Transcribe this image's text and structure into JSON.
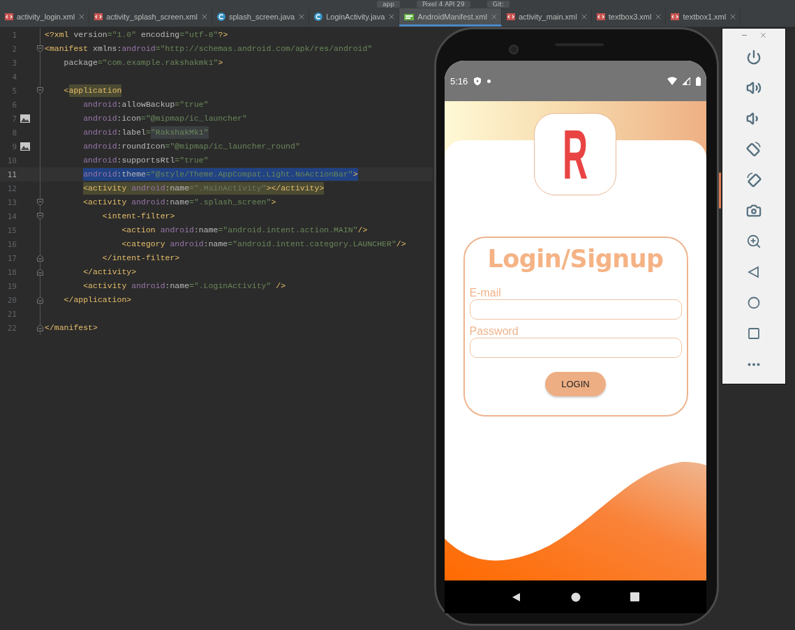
{
  "toolbar": {
    "items": [
      "app",
      "Pixel 4 API 29",
      "Git:"
    ]
  },
  "tabs": [
    {
      "label": "activity_login.xml",
      "kind": "xml",
      "selected": false
    },
    {
      "label": "activity_splash_screen.xml",
      "kind": "xml",
      "selected": false
    },
    {
      "label": "splash_screen.java",
      "kind": "java",
      "selected": false
    },
    {
      "label": "LoginActivity.java",
      "kind": "java",
      "selected": false
    },
    {
      "label": "AndroidManifest.xml",
      "kind": "manifest",
      "selected": true
    },
    {
      "label": "activity_main.xml",
      "kind": "xml",
      "selected": false
    },
    {
      "label": "textbox3.xml",
      "kind": "xml",
      "selected": false
    },
    {
      "label": "textbox1.xml",
      "kind": "xml",
      "selected": false
    }
  ],
  "code_lines": [
    {
      "number": "1",
      "current": false,
      "segments": [
        {
          "kind": "tag",
          "text": "<?xml "
        },
        {
          "kind": "attr",
          "text": "version"
        },
        {
          "kind": "val",
          "text": "=\"1.0\" "
        },
        {
          "kind": "attr",
          "text": "encoding"
        },
        {
          "kind": "val",
          "text": "=\"utf-8\""
        },
        {
          "kind": "tag",
          "text": "?>"
        }
      ]
    },
    {
      "number": "2",
      "current": false,
      "fold_marker": {
        "kind": "start"
      },
      "segments": [
        {
          "kind": "tag",
          "text": "<manifest "
        },
        {
          "kind": "attr",
          "text": "xmlns:"
        },
        {
          "kind": "ns",
          "text": "android"
        },
        {
          "kind": "val",
          "text": "=\"http://schemas.android.com/apk/res/android\""
        }
      ]
    },
    {
      "number": "3",
      "current": false,
      "segments": [
        {
          "kind": "attr",
          "text": "    package"
        },
        {
          "kind": "val",
          "text": "=\"com.example.rakshakmk1\""
        },
        {
          "kind": "tag",
          "text": ">"
        }
      ]
    },
    {
      "number": "4",
      "current": false
    },
    {
      "number": "5",
      "current": false,
      "fold_marker": {
        "kind": "start"
      },
      "segments": [
        {
          "kind": "tag",
          "text": "    <"
        },
        {
          "kind": "tag",
          "text": "application",
          "highlight": {
            "kind": "match"
          }
        }
      ]
    },
    {
      "number": "6",
      "current": false,
      "segments": [
        {
          "kind": "ns",
          "text": "        android"
        },
        {
          "kind": "attr",
          "text": ":allowBackup"
        },
        {
          "kind": "val",
          "text": "=\"true\""
        }
      ]
    },
    {
      "number": "7",
      "current": false,
      "gutter_icon": {
        "kind": "image"
      },
      "segments": [
        {
          "kind": "ns",
          "text": "        android"
        },
        {
          "kind": "attr",
          "text": ":icon"
        },
        {
          "kind": "val",
          "text": "=\"@mipmap/ic_launcher\""
        }
      ]
    },
    {
      "number": "8",
      "current": false,
      "segments": [
        {
          "kind": "ns",
          "text": "        android"
        },
        {
          "kind": "attr",
          "text": ":label"
        },
        {
          "kind": "val",
          "text": "="
        },
        {
          "kind": "val",
          "text": "\"RakshakMk1\"",
          "highlight": {
            "kind": "folded"
          }
        }
      ]
    },
    {
      "number": "9",
      "current": false,
      "gutter_icon": {
        "kind": "image"
      },
      "segments": [
        {
          "kind": "ns",
          "text": "        android"
        },
        {
          "kind": "attr",
          "text": ":roundIcon"
        },
        {
          "kind": "val",
          "text": "=\"@mipmap/ic_launcher_round\""
        }
      ]
    },
    {
      "number": "10",
      "current": false,
      "segments": [
        {
          "kind": "ns",
          "text": "        android"
        },
        {
          "kind": "attr",
          "text": ":supportsRtl"
        },
        {
          "kind": "val",
          "text": "=\"true\""
        }
      ]
    },
    {
      "number": "11",
      "current": true,
      "segments": [
        {
          "kind": "ns",
          "text": "        android",
          "highlight": {
            "kind": "selection"
          }
        },
        {
          "kind": "attr",
          "text": ":theme",
          "highlight": {
            "kind": "selection"
          }
        },
        {
          "kind": "val",
          "text": "=\"@style/Theme.AppCompat.Light.NoActionBar\"",
          "highlight": {
            "kind": "selection"
          }
        },
        {
          "kind": "tag",
          "text": ">",
          "highlight": {
            "kind": "selection"
          }
        }
      ]
    },
    {
      "number": "12",
      "current": false,
      "segments": [
        {
          "kind": "tag",
          "text": "        <activity ",
          "highlight": {
            "kind": "match"
          }
        },
        {
          "kind": "ns",
          "text": "android",
          "highlight": {
            "kind": "match"
          }
        },
        {
          "kind": "attr",
          "text": ":name",
          "highlight": {
            "kind": "match"
          }
        },
        {
          "kind": "dim",
          "text": "=\".MainActivity\"",
          "highlight": {
            "kind": "match"
          }
        },
        {
          "kind": "tag",
          "text": "></activity>",
          "highlight": {
            "kind": "match"
          }
        }
      ]
    },
    {
      "number": "13",
      "current": false,
      "fold_marker": {
        "kind": "start"
      },
      "segments": [
        {
          "kind": "tag",
          "text": "        <activity "
        },
        {
          "kind": "ns",
          "text": "android"
        },
        {
          "kind": "attr",
          "text": ":name"
        },
        {
          "kind": "val",
          "text": "=\".splash_screen\""
        },
        {
          "kind": "tag",
          "text": ">"
        }
      ]
    },
    {
      "number": "14",
      "current": false,
      "fold_marker": {
        "kind": "start"
      },
      "segments": [
        {
          "kind": "tag",
          "text": "            <intent-filter>"
        }
      ]
    },
    {
      "number": "15",
      "current": false,
      "segments": [
        {
          "kind": "tag",
          "text": "                <action "
        },
        {
          "kind": "ns",
          "text": "android"
        },
        {
          "kind": "attr",
          "text": ":name"
        },
        {
          "kind": "val",
          "text": "=\"android.intent.action.MAIN\""
        },
        {
          "kind": "tag",
          "text": "/>"
        }
      ]
    },
    {
      "number": "16",
      "current": false,
      "segments": [
        {
          "kind": "tag",
          "text": "                <category "
        },
        {
          "kind": "ns",
          "text": "android"
        },
        {
          "kind": "attr",
          "text": ":name"
        },
        {
          "kind": "val",
          "text": "=\"android.intent.category.LAUNCHER\""
        },
        {
          "kind": "tag",
          "text": "/>"
        }
      ]
    },
    {
      "number": "17",
      "current": false,
      "fold_marker": {
        "kind": "end"
      },
      "segments": [
        {
          "kind": "tag",
          "text": "            </intent-filter>"
        }
      ]
    },
    {
      "number": "18",
      "current": false,
      "fold_marker": {
        "kind": "end"
      },
      "segments": [
        {
          "kind": "tag",
          "text": "        </activity>"
        }
      ]
    },
    {
      "number": "19",
      "current": false,
      "segments": [
        {
          "kind": "tag",
          "text": "        <activity "
        },
        {
          "kind": "ns",
          "text": "android"
        },
        {
          "kind": "attr",
          "text": ":name"
        },
        {
          "kind": "val",
          "text": "=\".LoginActivity\" "
        },
        {
          "kind": "tag",
          "text": "/>"
        }
      ]
    },
    {
      "number": "20",
      "current": false,
      "fold_marker": {
        "kind": "end"
      },
      "segments": [
        {
          "kind": "tag",
          "text": "    </application>"
        }
      ]
    },
    {
      "number": "21",
      "current": false
    },
    {
      "number": "22",
      "current": false,
      "fold_marker": {
        "kind": "end"
      },
      "segments": [
        {
          "kind": "tag",
          "text": "</manifest>"
        }
      ]
    }
  ],
  "phone": {
    "status_bar": {
      "time": "5:16"
    },
    "logo": {
      "text": "R"
    },
    "form": {
      "title": "Login/Signup",
      "fields": [
        {
          "label": "E-mail"
        },
        {
          "label": "Password"
        }
      ],
      "button": "LOGIN"
    }
  }
}
